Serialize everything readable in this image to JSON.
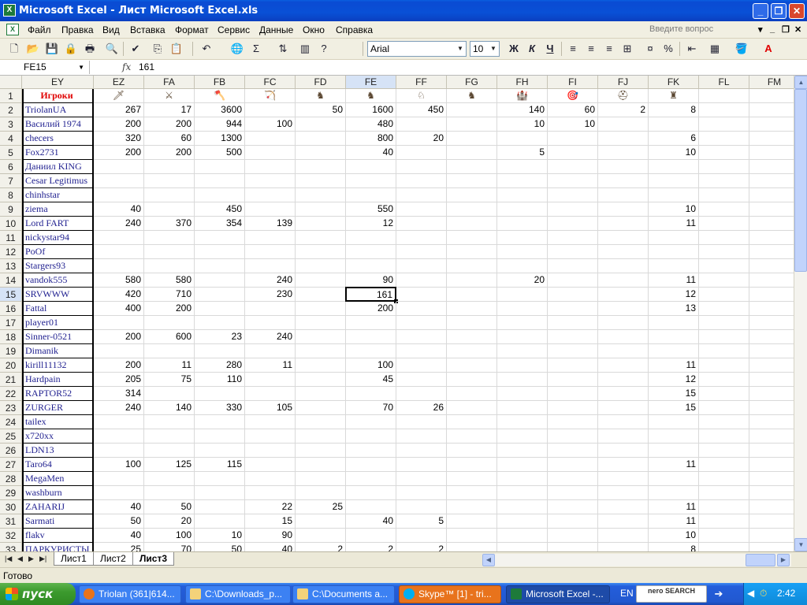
{
  "window": {
    "title": "Microsoft Excel - Лист Microsoft Excel.xls"
  },
  "menu": {
    "items": [
      "Файл",
      "Правка",
      "Вид",
      "Вставка",
      "Формат",
      "Сервис",
      "Данные",
      "Окно",
      "Справка"
    ],
    "question_placeholder": "Введите вопрос"
  },
  "toolbar": {
    "font": "Arial",
    "size": "10",
    "bold": "Ж",
    "italic": "К",
    "underline": "Ч",
    "sigma": "Σ",
    "percent": "%"
  },
  "formula_bar": {
    "name_box": "FE15",
    "fx": "fx",
    "value": "161"
  },
  "grid": {
    "columns": [
      "EY",
      "EZ",
      "FA",
      "FB",
      "FC",
      "FD",
      "FE",
      "FF",
      "FG",
      "FH",
      "FI",
      "FJ",
      "FK",
      "FL",
      "FM"
    ],
    "header_label": "Игроки",
    "rows": [
      {
        "n": "2",
        "name": "TriolanUA",
        "v": [
          "267",
          "17",
          "3600",
          "",
          "50",
          "1600",
          "450",
          "",
          "140",
          "60",
          "2",
          "8"
        ]
      },
      {
        "n": "3",
        "name": "Василий 1974",
        "v": [
          "200",
          "200",
          "944",
          "100",
          "",
          "480",
          "",
          "",
          "10",
          "10",
          "",
          ""
        ]
      },
      {
        "n": "4",
        "name": "checers",
        "v": [
          "320",
          "60",
          "1300",
          "",
          "",
          "800",
          "20",
          "",
          "",
          "",
          "",
          "6"
        ]
      },
      {
        "n": "5",
        "name": "Fox2731",
        "v": [
          "200",
          "200",
          "500",
          "",
          "",
          "40",
          "",
          "",
          "5",
          "",
          "",
          "10"
        ]
      },
      {
        "n": "6",
        "name": "Даниил KING",
        "v": [
          "",
          "",
          "",
          "",
          "",
          "",
          "",
          "",
          "",
          "",
          "",
          ""
        ]
      },
      {
        "n": "7",
        "name": "Cesar Legitimus",
        "v": [
          "",
          "",
          "",
          "",
          "",
          "",
          "",
          "",
          "",
          "",
          "",
          ""
        ]
      },
      {
        "n": "8",
        "name": "chinhstar",
        "v": [
          "",
          "",
          "",
          "",
          "",
          "",
          "",
          "",
          "",
          "",
          "",
          ""
        ]
      },
      {
        "n": "9",
        "name": "ziema",
        "v": [
          "40",
          "",
          "450",
          "",
          "",
          "550",
          "",
          "",
          "",
          "",
          "",
          "10"
        ]
      },
      {
        "n": "10",
        "name": "Lord FART",
        "v": [
          "240",
          "370",
          "354",
          "139",
          "",
          "12",
          "",
          "",
          "",
          "",
          "",
          "11"
        ]
      },
      {
        "n": "11",
        "name": "nickystar94",
        "v": [
          "",
          "",
          "",
          "",
          "",
          "",
          "",
          "",
          "",
          "",
          "",
          ""
        ]
      },
      {
        "n": "12",
        "name": "PoOf",
        "v": [
          "",
          "",
          "",
          "",
          "",
          "",
          "",
          "",
          "",
          "",
          "",
          ""
        ]
      },
      {
        "n": "13",
        "name": "Stargers93",
        "v": [
          "",
          "",
          "",
          "",
          "",
          "",
          "",
          "",
          "",
          "",
          "",
          ""
        ]
      },
      {
        "n": "14",
        "name": "vandok555",
        "v": [
          "580",
          "580",
          "",
          "240",
          "",
          "90",
          "",
          "",
          "20",
          "",
          "",
          "11"
        ]
      },
      {
        "n": "15",
        "name": "SRVWWW",
        "v": [
          "420",
          "710",
          "",
          "230",
          "",
          "161",
          "",
          "",
          "",
          "",
          "",
          "12"
        ]
      },
      {
        "n": "16",
        "name": "Fattal",
        "v": [
          "400",
          "200",
          "",
          "",
          "",
          "200",
          "",
          "",
          "",
          "",
          "",
          "13"
        ]
      },
      {
        "n": "17",
        "name": "player01",
        "v": [
          "",
          "",
          "",
          "",
          "",
          "",
          "",
          "",
          "",
          "",
          "",
          ""
        ]
      },
      {
        "n": "18",
        "name": "Sinner-0521",
        "v": [
          "200",
          "600",
          "23",
          "240",
          "",
          "",
          "",
          "",
          "",
          "",
          "",
          ""
        ]
      },
      {
        "n": "19",
        "name": "Dimanik",
        "v": [
          "",
          "",
          "",
          "",
          "",
          "",
          "",
          "",
          "",
          "",
          "",
          ""
        ]
      },
      {
        "n": "20",
        "name": "kirill11132",
        "v": [
          "200",
          "11",
          "280",
          "11",
          "",
          "100",
          "",
          "",
          "",
          "",
          "",
          "11"
        ]
      },
      {
        "n": "21",
        "name": "Hardpain",
        "v": [
          "205",
          "75",
          "110",
          "",
          "",
          "45",
          "",
          "",
          "",
          "",
          "",
          "12"
        ]
      },
      {
        "n": "22",
        "name": "RAPTOR52",
        "v": [
          "314",
          "",
          "",
          "",
          "",
          "",
          "",
          "",
          "",
          "",
          "",
          "15"
        ]
      },
      {
        "n": "23",
        "name": "ZURGER",
        "v": [
          "240",
          "140",
          "330",
          "105",
          "",
          "70",
          "26",
          "",
          "",
          "",
          "",
          "15"
        ]
      },
      {
        "n": "24",
        "name": "tailex",
        "v": [
          "",
          "",
          "",
          "",
          "",
          "",
          "",
          "",
          "",
          "",
          "",
          ""
        ]
      },
      {
        "n": "25",
        "name": "x720xx",
        "v": [
          "",
          "",
          "",
          "",
          "",
          "",
          "",
          "",
          "",
          "",
          "",
          ""
        ]
      },
      {
        "n": "26",
        "name": "LDN13",
        "v": [
          "",
          "",
          "",
          "",
          "",
          "",
          "",
          "",
          "",
          "",
          "",
          ""
        ]
      },
      {
        "n": "27",
        "name": "Taro64",
        "v": [
          "100",
          "125",
          "115",
          "",
          "",
          "",
          "",
          "",
          "",
          "",
          "",
          "11"
        ]
      },
      {
        "n": "28",
        "name": "MegaMen",
        "v": [
          "",
          "",
          "",
          "",
          "",
          "",
          "",
          "",
          "",
          "",
          "",
          ""
        ]
      },
      {
        "n": "29",
        "name": "washburn",
        "v": [
          "",
          "",
          "",
          "",
          "",
          "",
          "",
          "",
          "",
          "",
          "",
          ""
        ]
      },
      {
        "n": "30",
        "name": "ZAHARIJ",
        "v": [
          "40",
          "50",
          "",
          "22",
          "25",
          "",
          "",
          "",
          "",
          "",
          "",
          "11"
        ]
      },
      {
        "n": "31",
        "name": "Sarmati",
        "v": [
          "50",
          "20",
          "",
          "15",
          "",
          "40",
          "5",
          "",
          "",
          "",
          "",
          "11"
        ]
      },
      {
        "n": "32",
        "name": "flakv",
        "v": [
          "40",
          "100",
          "10",
          "90",
          "",
          "",
          "",
          "",
          "",
          "",
          "",
          "10"
        ]
      },
      {
        "n": "33",
        "name": "ПАРКУРИСТЫ",
        "v": [
          "25",
          "70",
          "50",
          "40",
          "2",
          "2",
          "2",
          "",
          "",
          "",
          "",
          "8"
        ]
      }
    ],
    "icons": [
      "spear-icon",
      "crossed-swords-icon",
      "axe-icon",
      "crossbow-icon",
      "horse-icon",
      "horseman-icon",
      "knight-icon",
      "dark-knight-icon",
      "catapult-icon",
      "ballista-icon",
      "helmet-icon",
      "army-icon"
    ]
  },
  "sheets": {
    "tabs": [
      "Лист1",
      "Лист2",
      "Лист3"
    ],
    "active": 2
  },
  "status": "Готово",
  "taskbar": {
    "start": "пуск",
    "tasks": [
      "Triolan (361|614...",
      "C:\\Downloads_p...",
      "C:\\Documents a...",
      "Skype™ [1] - tri...",
      "Microsoft Excel -..."
    ],
    "lang": "EN",
    "nero": "nero SEARCH",
    "clock": "2:42"
  },
  "colors": {
    "header_text": "#e00000",
    "names": "#1f1f8f",
    "selection": "#d6e3f6"
  }
}
